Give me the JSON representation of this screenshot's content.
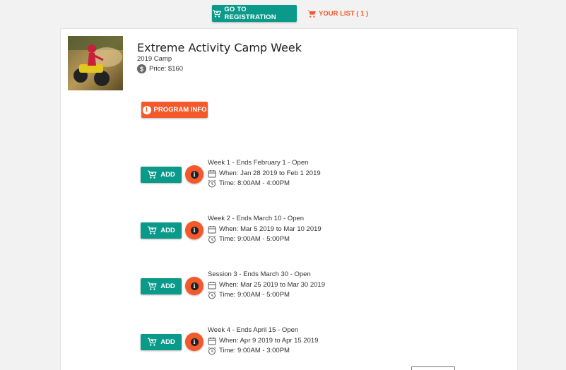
{
  "header": {
    "registration_label": "GO TO REGISTRATION",
    "your_list_label": "YOUR LIST ( 1 )"
  },
  "program": {
    "title": "Extreme Activity Camp Week",
    "subtitle": "2019 Camp",
    "price": "Price: $160",
    "info_button": "PROGRAM INFO"
  },
  "sessions": [
    {
      "add_label": "ADD",
      "name": "Week 1 - Ends February 1 - Open",
      "when": "When: Jan 28 2019 to Feb 1 2019",
      "time": "Time: 8:00AM - 4:00PM"
    },
    {
      "add_label": "ADD",
      "name": "Week 2 - Ends March 10 - Open",
      "when": "When: Mar 5 2019 to Mar 10 2019",
      "time": "Time: 9:00AM - 5:00PM"
    },
    {
      "add_label": "ADD",
      "name": "Session 3 - Ends March 30 - Open",
      "when": "When: Mar 25 2019 to Mar 30 2019",
      "time": "Time: 9:00AM - 5:00PM"
    },
    {
      "add_label": "ADD",
      "name": "Week 4 - Ends April 15 - Open",
      "when": "When: Apr 9 2019 to Apr 15 2019",
      "time": "Time: 9:00AM - 3:00PM"
    }
  ],
  "colors": {
    "teal": "#0a9a8a",
    "orange": "#f4592b"
  },
  "icons": [
    "cart-plus-icon",
    "cart-icon",
    "dollar-icon",
    "info-icon",
    "calendar-icon",
    "alarm-clock-icon"
  ]
}
